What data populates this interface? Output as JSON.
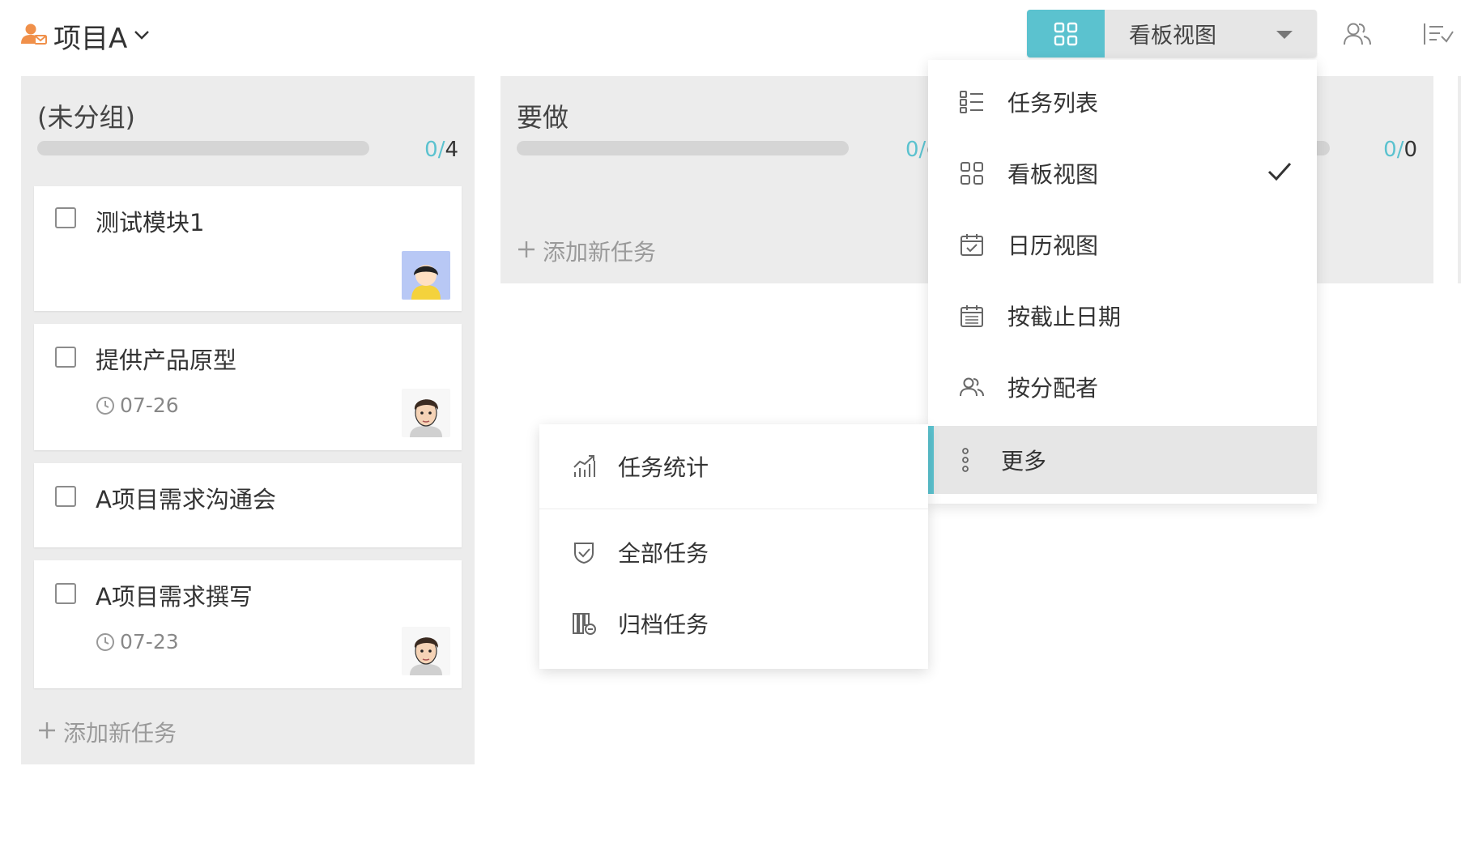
{
  "header": {
    "project_name": "项目A",
    "view_selector_label": "看板视图"
  },
  "columns": [
    {
      "title": "(未分组)",
      "done": "0",
      "sep": "/",
      "total": "4",
      "add_task_label": "添加新任务",
      "cards": [
        {
          "title": "测试模块1",
          "date": "",
          "avatar": "child-avatar"
        },
        {
          "title": "提供产品原型",
          "date": "07-26",
          "avatar": "man-avatar"
        },
        {
          "title": "A项目需求沟通会",
          "date": "",
          "avatar": ""
        },
        {
          "title": "A项目需求撰写",
          "date": "07-23",
          "avatar": "man-avatar"
        }
      ]
    },
    {
      "title": "要做",
      "done": "0",
      "sep": "/",
      "total": "(",
      "add_task_label": "添加新任务",
      "cards": []
    },
    {
      "title": "",
      "done": "0",
      "sep": "/",
      "total": "0",
      "cards": []
    }
  ],
  "view_menu": {
    "items": [
      {
        "label": "任务列表",
        "icon": "list-icon"
      },
      {
        "label": "看板视图",
        "icon": "board-icon",
        "selected": true
      },
      {
        "label": "日历视图",
        "icon": "calendar-icon"
      },
      {
        "label": "按截止日期",
        "icon": "due-date-icon"
      },
      {
        "label": "按分配者",
        "icon": "assignee-icon"
      },
      {
        "label": "更多",
        "icon": "more-vertical-icon",
        "highlighted": true
      }
    ]
  },
  "more_menu": {
    "items": [
      {
        "label": "任务统计",
        "icon": "stats-icon"
      },
      {
        "label": "全部任务",
        "icon": "all-tasks-icon"
      },
      {
        "label": "归档任务",
        "icon": "archive-icon"
      }
    ]
  },
  "colors": {
    "accent": "#5bc2cf",
    "column_bg": "#ececec",
    "user_icon": "#f0904a"
  }
}
